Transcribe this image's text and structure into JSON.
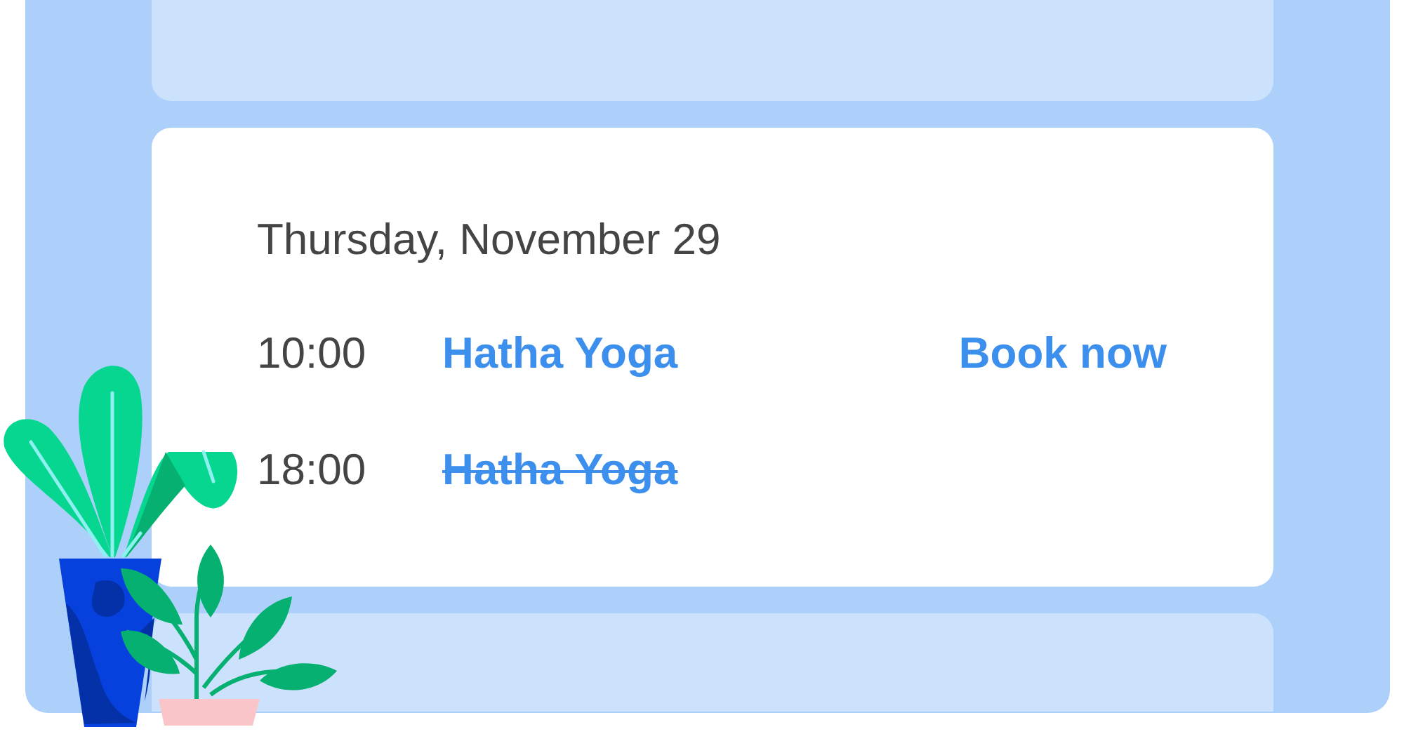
{
  "schedule": {
    "date": "Thursday, November 29",
    "sessions": [
      {
        "time": "10:00",
        "title": "Hatha Yoga",
        "cancelled": false,
        "action": "Book now"
      },
      {
        "time": "18:00",
        "title": "Hatha Yoga",
        "cancelled": true
      }
    ]
  }
}
